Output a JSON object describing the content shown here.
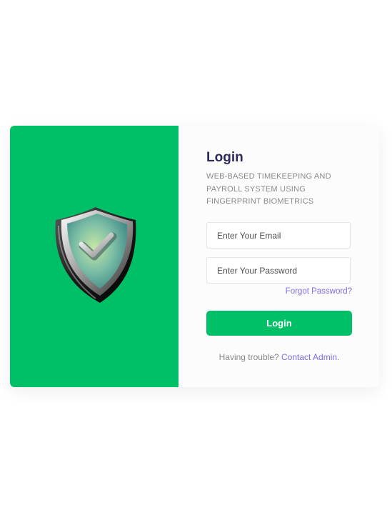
{
  "login": {
    "title": "Login",
    "subtitle": "WEB-BASED TIMEKEEPING AND PAYROLL SYSTEM USING FINGERPRINT BIOMETRICS",
    "email_placeholder": "Enter Your Email",
    "email_value": "",
    "password_placeholder": "Enter Your Password",
    "password_value": "",
    "forgot_label": "Forgot Password?",
    "button_label": "Login",
    "help_text": "Having trouble? ",
    "help_link": "Contact Admin",
    "help_suffix": "."
  },
  "illustration": {
    "icon": "shield-check-icon"
  },
  "colors": {
    "brand_green": "#00c067",
    "title": "#2b2a5a",
    "link": "#7b6ee6",
    "muted_text": "#8a8a8a"
  }
}
